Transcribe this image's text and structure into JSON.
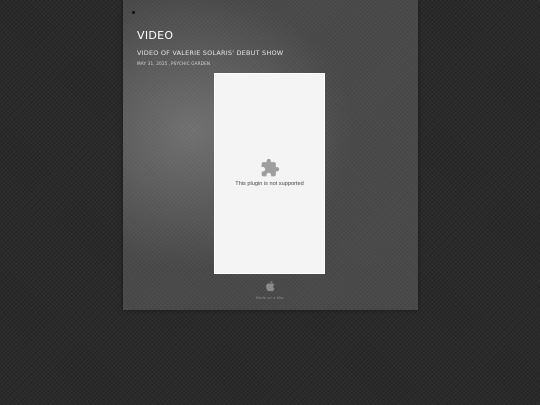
{
  "section": {
    "title": "VIDEO"
  },
  "post": {
    "title": "VIDEO OF VALERIE SOLARIS' DEBUT SHOW",
    "date": "MAY 31, 2025",
    "separator": ",",
    "category": "PSYCHIC GARDEN"
  },
  "video": {
    "plugin_message": "This plugin is not supported",
    "plugin_icon": "puzzle-piece-icon"
  },
  "footer": {
    "badge_icon": "apple-icon",
    "badge_text": "Made on a Mac"
  },
  "colors": {
    "background": "#2b2b2b",
    "panel": "#4a4a4a",
    "title_text": "#ffffff",
    "plugin_bg": "#f4f4f4",
    "plugin_icon": "#9e9e9e"
  }
}
